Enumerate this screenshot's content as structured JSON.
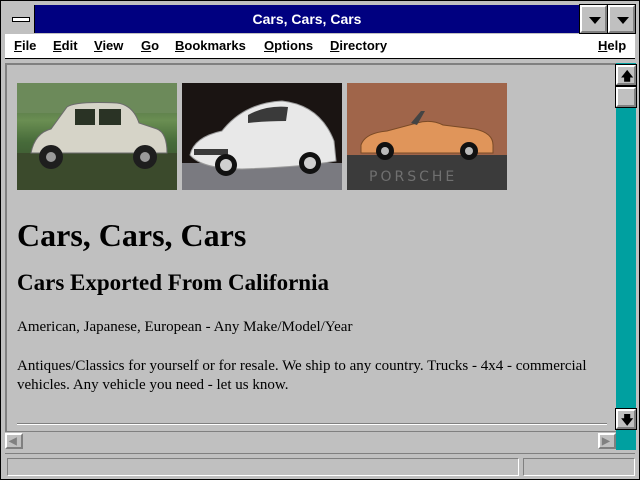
{
  "window": {
    "title": "Cars, Cars, Cars"
  },
  "menu": {
    "items": [
      {
        "label": "File",
        "key": "F",
        "rest": "ile"
      },
      {
        "label": "Edit",
        "key": "E",
        "rest": "dit"
      },
      {
        "label": "View",
        "key": "V",
        "rest": "iew"
      },
      {
        "label": "Go",
        "key": "G",
        "rest": "o"
      },
      {
        "label": "Bookmarks",
        "key": "B",
        "rest": "ookmarks"
      },
      {
        "label": "Options",
        "key": "O",
        "rest": "ptions"
      },
      {
        "label": "Directory",
        "key": "D",
        "rest": "irectory"
      },
      {
        "label": "Help",
        "key": "H",
        "rest": "elp"
      }
    ]
  },
  "page": {
    "images": [
      "car-photo-classic-citroen",
      "car-photo-white-porsche-959",
      "car-photo-porsche-cabriolet"
    ],
    "logo_text": "PORSCHE",
    "heading": "Cars, Cars, Cars",
    "subheading": "Cars Exported From California",
    "paragraph1": "American, Japanese, European - Any Make/Model/Year",
    "paragraph2": "Antiques/Classics for yourself or for resale. We ship to any country. Trucks - 4x4 - commercial vehicles. Any vehicle you need - let us know."
  },
  "scrollbar": {
    "up_glyph": "🡅",
    "down_glyph": "🡇",
    "left_glyph": "◀",
    "right_glyph": "▶"
  },
  "status": {
    "text": ""
  },
  "colors": {
    "titlebar": "#000080",
    "chrome": "#c0c0c0",
    "desktop": "#008080"
  }
}
